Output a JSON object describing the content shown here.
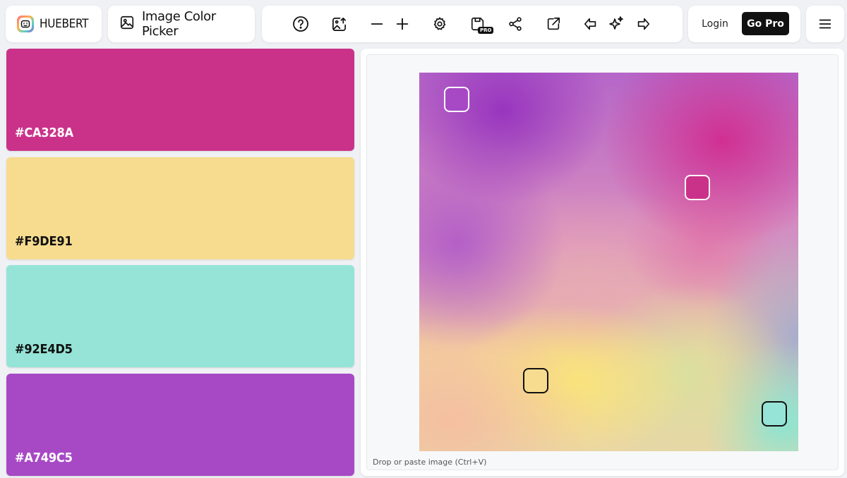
{
  "brand": {
    "name": "HUEBERT",
    "icon": "huebert-logo-icon"
  },
  "tool": {
    "label": "Image Color Picker",
    "icon": "image-icon"
  },
  "toolbar": {
    "help_icon": "help-circle-icon",
    "upload_icon": "image-upload-icon",
    "minus_icon": "minus-icon",
    "plus_icon": "plus-icon",
    "settings_icon": "gear-icon",
    "save_icon": "save-icon",
    "pro_badge": "PRO",
    "share_icon": "share-icon",
    "export_icon": "external-link-icon",
    "back_icon": "arrow-left-icon",
    "sparkle_icon": "sparkles-icon",
    "forward_icon": "arrow-right-icon"
  },
  "auth": {
    "login_label": "Login",
    "gopro_label": "Go Pro"
  },
  "menu": {
    "icon": "hamburger-menu-icon"
  },
  "palette": [
    {
      "hex": "#CA328A",
      "color": "#ca328a",
      "text_color": "#ffffff"
    },
    {
      "hex": "#F9DE91",
      "color": "#f7dc8f",
      "text_color": "#111111"
    },
    {
      "hex": "#92E4D5",
      "color": "#95e4d7",
      "text_color": "#111111"
    },
    {
      "hex": "#A749C5",
      "color": "#a749c5",
      "text_color": "#ffffff"
    }
  ],
  "canvas": {
    "drop_hint": "Drop or paste image (Ctrl+V)"
  }
}
